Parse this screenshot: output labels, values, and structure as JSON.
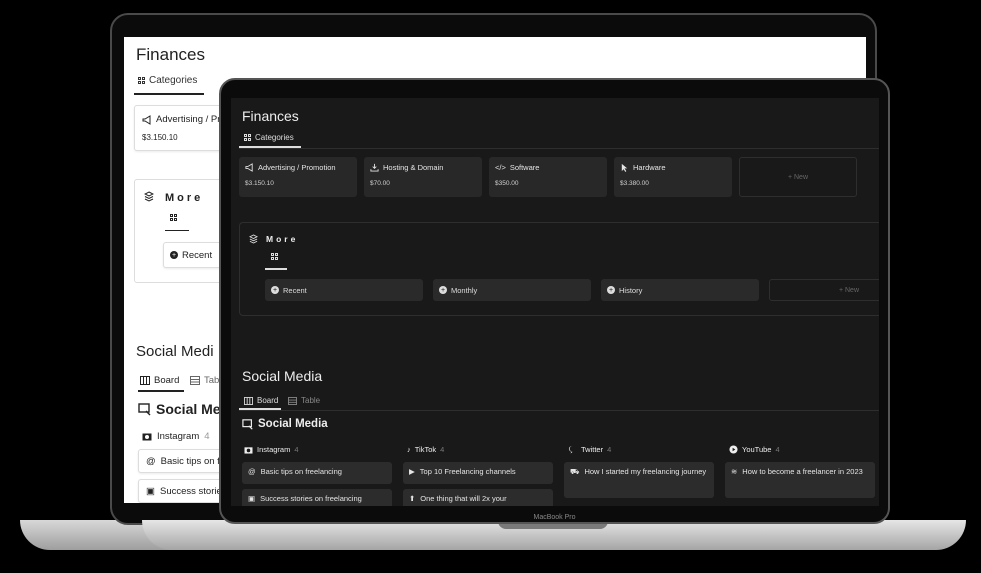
{
  "back": {
    "title": "Finances",
    "tab": "Categories",
    "card1_title": "Advertising / Pr",
    "card1_value": "$3.150.10",
    "more": "More",
    "recent": "Recent",
    "social_title": "Social Medi",
    "board_tab": "Board",
    "table_tab": "Tabl",
    "board_heading": "Social Me",
    "instagram": "Instagram",
    "instagram_count": "4",
    "post1": "Basic tips on fr",
    "post2": "Success stories"
  },
  "device_label": "MacBook Pro",
  "front": {
    "title": "Finances",
    "tab_categories": "Categories",
    "categories": [
      {
        "label": "Advertising / Promotion",
        "value": "$3.150.10",
        "icon": "megaphone-icon"
      },
      {
        "label": "Hosting & Domain",
        "value": "$70.00",
        "icon": "download-icon"
      },
      {
        "label": "Software",
        "value": "$350.00",
        "icon": "code-icon"
      },
      {
        "label": "Hardware",
        "value": "$3.380.00",
        "icon": "cursor-icon"
      }
    ],
    "new_label": "+ New",
    "more": {
      "title": "More",
      "items": [
        "Recent",
        "Monthly",
        "History"
      ],
      "new_label": "+ New"
    },
    "social": {
      "title": "Social Media",
      "tab_board": "Board",
      "tab_table": "Table",
      "board_heading": "Social Media",
      "columns": [
        {
          "name": "Instagram",
          "count": "4",
          "icon": "camera-icon",
          "cards": [
            {
              "text": "Basic tips on freelancing",
              "icon": "at-icon"
            },
            {
              "text": "Success stories on freelancing",
              "icon": "chat-icon"
            }
          ]
        },
        {
          "name": "TikTok",
          "count": "4",
          "icon": "music-note-icon",
          "cards": [
            {
              "text": "Top 10 Freelancing channels",
              "icon": "play-icon"
            },
            {
              "text": "One thing that will 2x your",
              "icon": "arrow-up-icon"
            }
          ]
        },
        {
          "name": "Twitter",
          "count": "4",
          "icon": "chat-bubble-icon",
          "cards": [
            {
              "text": "How I started my freelancing journey",
              "icon": "car-icon"
            }
          ]
        },
        {
          "name": "YouTube",
          "count": "4",
          "icon": "play-circle-icon",
          "cards": [
            {
              "text": "How to become a freelancer in 2023",
              "icon": "stack-icon"
            }
          ]
        }
      ]
    }
  }
}
